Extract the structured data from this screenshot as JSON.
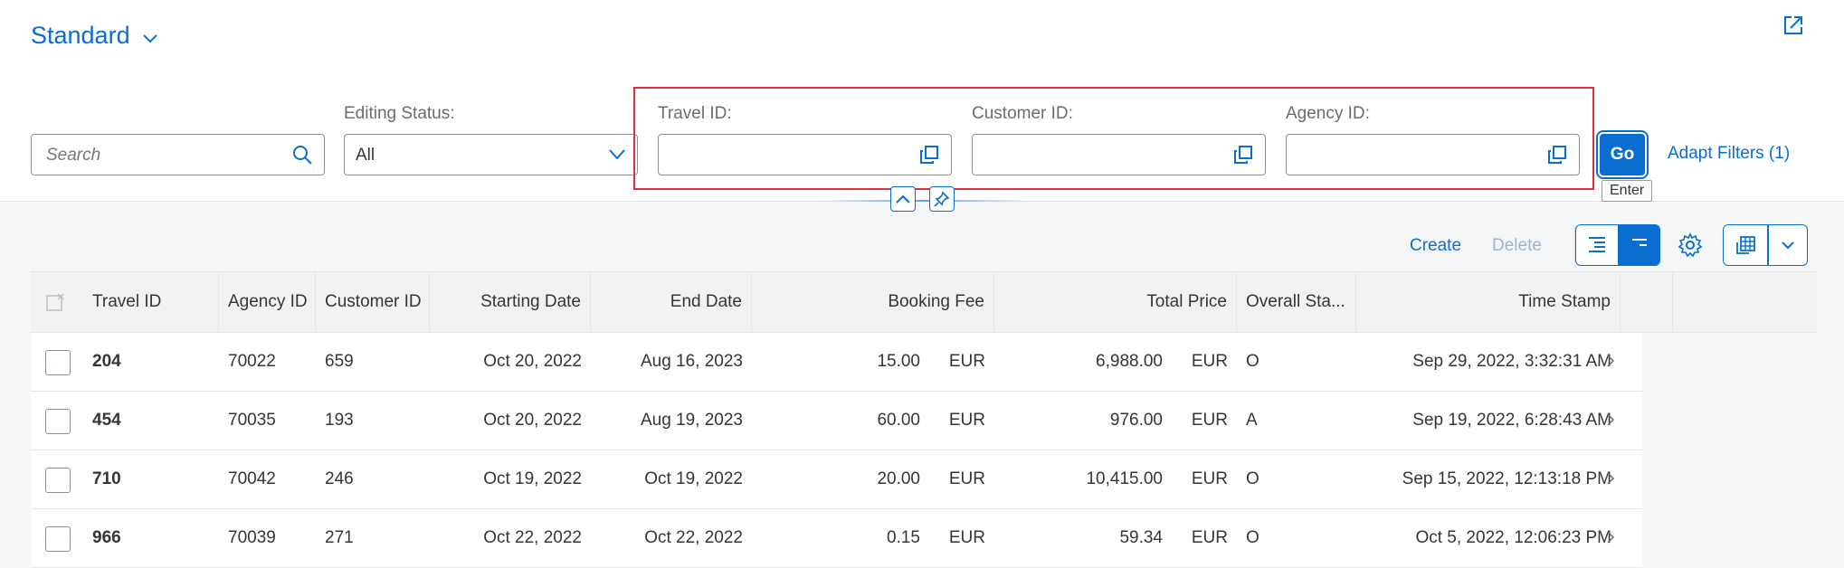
{
  "header": {
    "variant_title": "Standard"
  },
  "filters": {
    "search_placeholder": "Search",
    "editing_status_label": "Editing Status:",
    "editing_status_value": "All",
    "travel_id_label": "Travel ID:",
    "customer_id_label": "Customer ID:",
    "agency_id_label": "Agency ID:",
    "go_label": "Go",
    "go_tooltip": "Enter",
    "adapt_label": "Adapt Filters (1)"
  },
  "toolbar": {
    "create_label": "Create",
    "delete_label": "Delete"
  },
  "table": {
    "columns": [
      "Travel ID",
      "Agency ID",
      "Customer ID",
      "Starting Date",
      "End Date",
      "Booking Fee",
      "Total Price",
      "Overall Sta...",
      "Time Stamp"
    ],
    "rows": [
      {
        "travel_id": "204",
        "agency_id": "70022",
        "customer_id": "659",
        "start": "Oct 20, 2022",
        "end": "Aug 16, 2023",
        "fee": "15.00",
        "fee_cur": "EUR",
        "total": "6,988.00",
        "total_cur": "EUR",
        "status": "O",
        "timestamp": "Sep 29, 2022, 3:32:31 AM"
      },
      {
        "travel_id": "454",
        "agency_id": "70035",
        "customer_id": "193",
        "start": "Oct 20, 2022",
        "end": "Aug 19, 2023",
        "fee": "60.00",
        "fee_cur": "EUR",
        "total": "976.00",
        "total_cur": "EUR",
        "status": "A",
        "timestamp": "Sep 19, 2022, 6:28:43 AM"
      },
      {
        "travel_id": "710",
        "agency_id": "70042",
        "customer_id": "246",
        "start": "Oct 19, 2022",
        "end": "Oct 19, 2022",
        "fee": "20.00",
        "fee_cur": "EUR",
        "total": "10,415.00",
        "total_cur": "EUR",
        "status": "O",
        "timestamp": "Sep 15, 2022, 12:13:18 PM"
      },
      {
        "travel_id": "966",
        "agency_id": "70039",
        "customer_id": "271",
        "start": "Oct 22, 2022",
        "end": "Oct 22, 2022",
        "fee": "0.15",
        "fee_cur": "EUR",
        "total": "59.34",
        "total_cur": "EUR",
        "status": "O",
        "timestamp": "Oct 5, 2022, 12:06:23 PM"
      }
    ]
  },
  "colors": {
    "accent": "#0a6ed1",
    "highlight": "#e52d3a"
  }
}
